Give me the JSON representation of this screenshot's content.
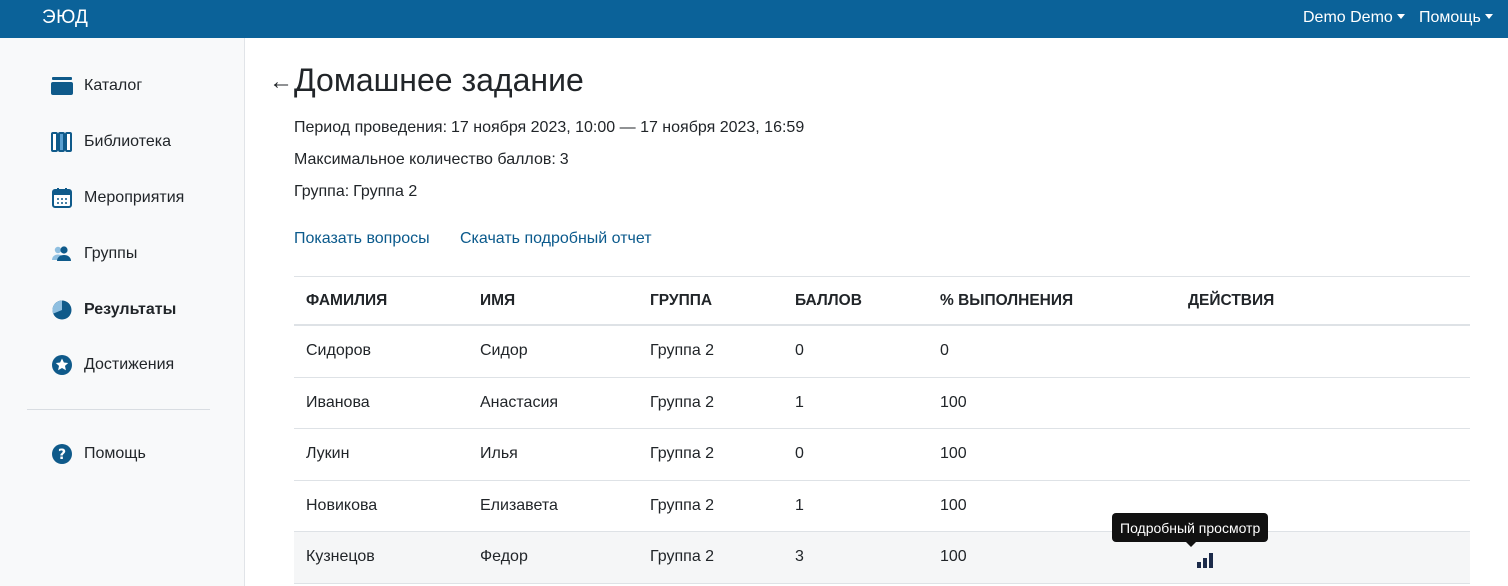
{
  "header": {
    "logo_text": "ЭЮД",
    "user_menu": "Demo Demo",
    "help_menu": "Помощь",
    "bar_color": "#0b6299"
  },
  "sidebar": {
    "items": [
      {
        "label": "Каталог",
        "icon": "catalog-icon"
      },
      {
        "label": "Библиотека",
        "icon": "library-icon"
      },
      {
        "label": "Мероприятия",
        "icon": "calendar-icon"
      },
      {
        "label": "Группы",
        "icon": "users-icon"
      },
      {
        "label": "Результаты",
        "icon": "pie-chart-icon",
        "active": true
      },
      {
        "label": "Достижения",
        "icon": "star-badge-icon"
      }
    ],
    "help": {
      "label": "Помощь",
      "icon": "question-icon"
    }
  },
  "main": {
    "back_arrow": "←",
    "title": "Домашнее задание",
    "period_label": "Период проведения:",
    "period_value": "17 ноября 2023, 10:00 — 17 ноября 2023, 16:59",
    "max_label": "Максимальное количество баллов:",
    "max_value": "3",
    "group_label": "Группа:",
    "group_value": "Группа 2",
    "show_questions": "Показать вопросы",
    "download_report": "Скачать подробный отчет",
    "link_color": "#0b5a8c"
  },
  "table": {
    "headers": [
      "Фамилия",
      "Имя",
      "Группа",
      "Баллов",
      "% выполнения",
      "Действия"
    ],
    "rows": [
      [
        "Сидоров",
        "Сидор",
        "Группа 2",
        "0",
        "0"
      ],
      [
        "Иванова",
        "Анастасия",
        "Группа 2",
        "1",
        "100"
      ],
      [
        "Лукин",
        "Илья",
        "Группа 2",
        "0",
        "100"
      ],
      [
        "Новикова",
        "Елизавета",
        "Группа 2",
        "1",
        "100"
      ],
      [
        "Кузнецов",
        "Федор",
        "Группа 2",
        "3",
        "100"
      ]
    ]
  },
  "tooltip": {
    "text": "Подробный просмотр",
    "icon": "bar-chart-icon"
  }
}
